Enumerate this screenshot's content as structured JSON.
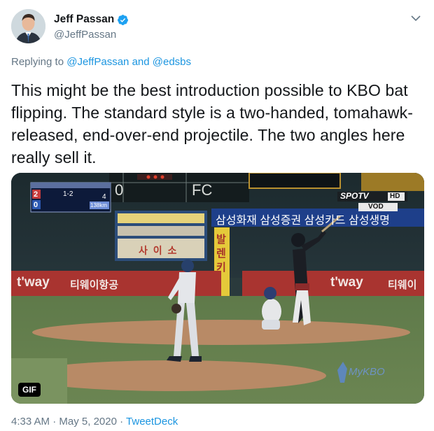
{
  "author": {
    "display_name": "Jeff Passan",
    "handle": "@JeffPassan",
    "verified": true
  },
  "reply": {
    "prefix": "Replying to",
    "mention_1": "@JeffPassan",
    "conjunction": "and",
    "mention_2": "@edsbs"
  },
  "tweet": {
    "text": "This might be the best introduction possible to KBO bat flipping. The standard style is a two-handed, tomahawk-released, end-over-end projectile. The two angles here really sell it."
  },
  "media": {
    "badge": "GIF",
    "broadcaster": "SPOTV",
    "broadcaster_hd": "HD",
    "vod": "VOD",
    "watermark": "MyKBO",
    "scoreboard": {
      "team1_score": "2",
      "team2_score": "0",
      "count": "1-2",
      "inning": "4",
      "pitch_speed": "138km"
    },
    "signs": {
      "korean_banner": "삼성화재 삼성증권 삼성카드 삼성생명",
      "tway_left": "t'way",
      "tway_text": "티웨이항공",
      "tway_right": "t'way",
      "tway_right_text": "티웨이",
      "billboard": "사 이 소",
      "vertical_sign": "발렌키",
      "fc": "FC",
      "board_zero": "0"
    }
  },
  "meta": {
    "time": "4:33 AM",
    "separator": "·",
    "date": "May 5, 2020",
    "source": "TweetDeck"
  },
  "colors": {
    "link": "#1b95e0",
    "secondary_text": "#657786",
    "verified": "#1da1f2"
  }
}
